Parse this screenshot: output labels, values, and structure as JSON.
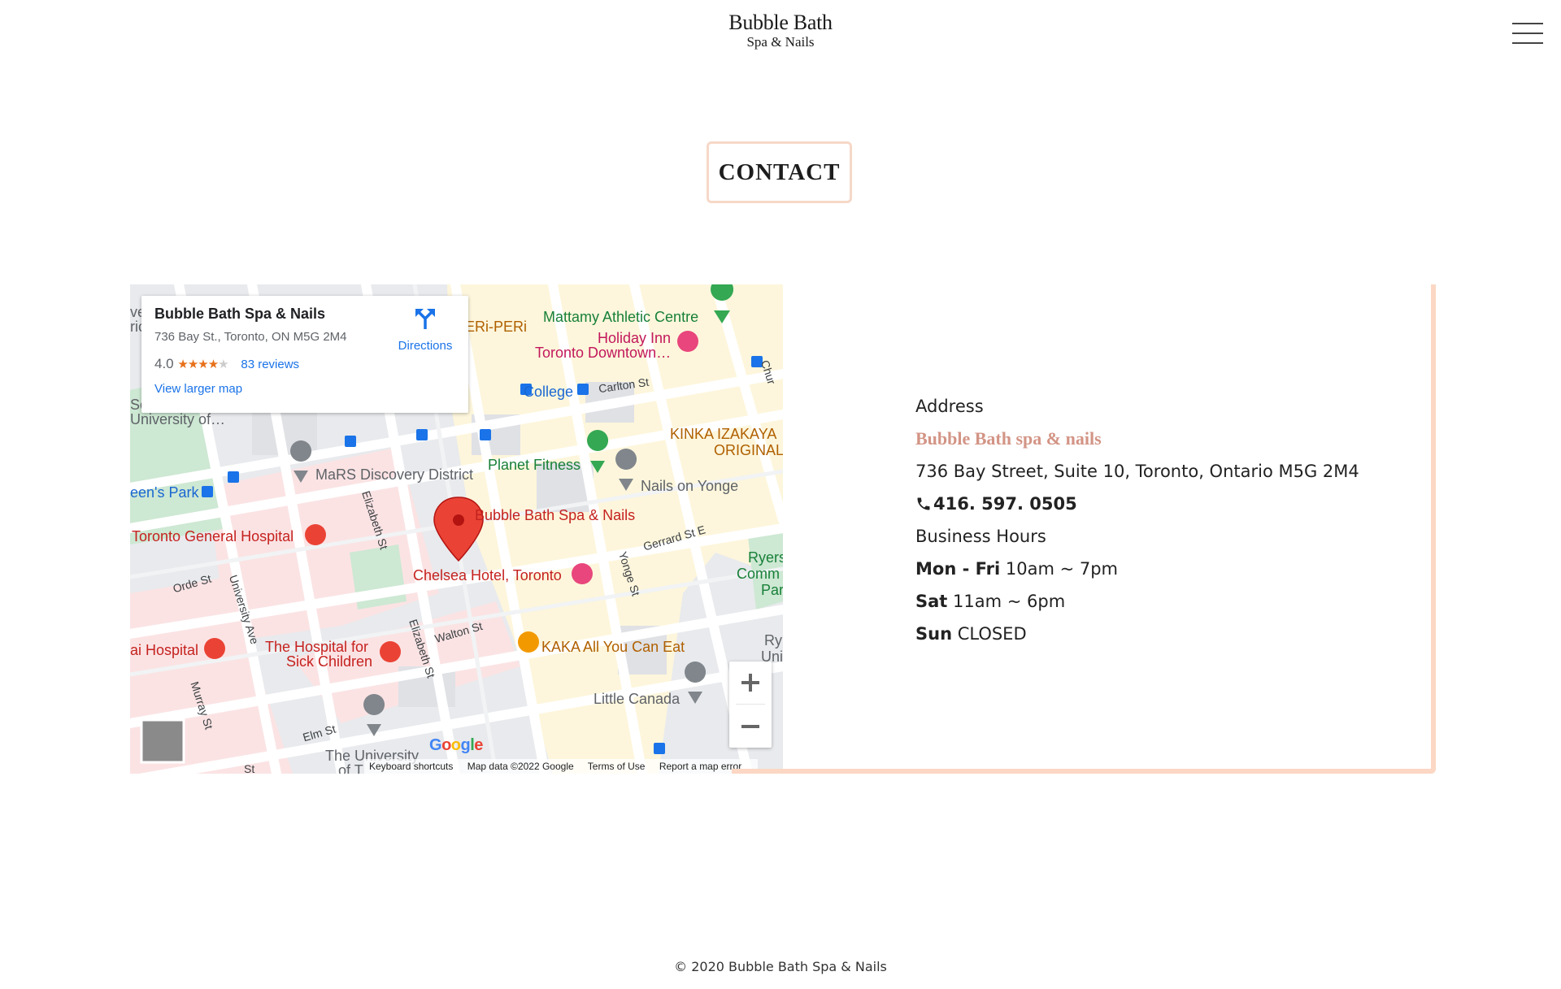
{
  "header": {
    "logo_line1": "Bubble Bath",
    "logo_line2": "Spa & Nails",
    "menu_icon": "hamburger-menu-icon"
  },
  "page": {
    "title": "CONTACT"
  },
  "map": {
    "info_window": {
      "name": "Bubble Bath Spa & Nails",
      "address": "736 Bay St., Toronto, ON M5G 2M4",
      "rating": "4.0",
      "stars": "★★★★",
      "star_empty": "★",
      "reviews": "83 reviews",
      "directions": "Directions",
      "larger_map": "View larger map"
    },
    "places": {
      "mattamy": "Mattamy Athletic Centre",
      "periperi": "ERi-PERi",
      "holiday_inn_1": "Holiday Inn",
      "holiday_inn_2": "Toronto Downtown…",
      "college": "College",
      "carlton": "Carlton St",
      "university_of": "University of…",
      "sc": "Sc",
      "ve": "ve",
      "ric": "ric",
      "kinka_1": "KINKA IZAKAYA",
      "kinka_2": "ORIGINAL",
      "mars": "MaRS Discovery District",
      "planet_fitness": "Planet Fitness",
      "nails_on_yonge": "Nails on Yonge",
      "queens_park": "een's Park",
      "bubble_bath": "Bubble Bath Spa & Nails",
      "toronto_general": "Toronto General Hospital",
      "gerrard": "Gerrard St E",
      "chelsea": "Chelsea Hotel, Toronto",
      "ryerson_1": "Ryers",
      "ryerson_2": "Comm",
      "ryerson_3": "Par",
      "orde": "Orde St",
      "university_ave": "University Ave",
      "elizabeth_1": "Elizabeth St",
      "elizabeth_2": "Elizabeth St",
      "yonge": "Yonge St",
      "walton": "Walton St",
      "mount_sinai": "ai Hospital",
      "sick_kids_1": "The Hospital for",
      "sick_kids_2": "Sick Children",
      "kaka": "KAKA All You Can Eat",
      "little_canada": "Little Canada",
      "ry": "Ry",
      "uni": "Uni",
      "murray": "Murray St",
      "elm": "Elm St",
      "the_university_1": "The University",
      "the_university_2": "of T",
      "chur": "Chur",
      "st": "St"
    },
    "google": "Google",
    "attribution": {
      "shortcuts": "Keyboard shortcuts",
      "map_data": "Map data ©2022 Google",
      "terms": "Terms of Use",
      "report": "Report a map error"
    },
    "zoom_in": "+",
    "zoom_out": "−"
  },
  "contact": {
    "address_label": "Address",
    "business_name": "Bubble Bath spa & nails",
    "street": "736 Bay Street, Suite 10, Toronto, Ontario M5G 2M4",
    "phone": "416. 597. 0505",
    "phone_icon": "phone-icon",
    "hours_label": "Business Hours",
    "hours": [
      {
        "day": "Mon - Fri",
        "time": " 10am ~ 7pm"
      },
      {
        "day": "Sat",
        "time": " 11am ~ 6pm"
      },
      {
        "day": "Sun",
        "time": " CLOSED"
      }
    ]
  },
  "footer": {
    "text": "© 2020 Bubble Bath Spa & Nails"
  },
  "colors": {
    "accent_border": "#fbd7c4",
    "business_name": "#d39485",
    "map_pin": "#ea4335"
  }
}
